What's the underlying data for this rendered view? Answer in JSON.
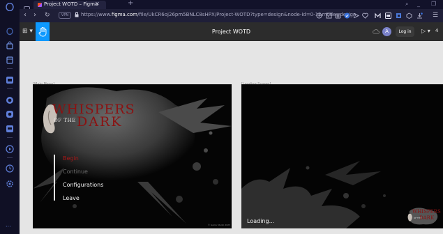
{
  "browser": {
    "tab_title": "Project WOTD – Figma",
    "tab_close": "✕",
    "new_tab": "+",
    "vpn_label": "VPN",
    "url_prefix": "https://www.",
    "url_domain": "figma.com",
    "url_path": "/file/UkCR6oj26pm5BNLC8sHPX/Project-WOTD?type=design&node-id=0-1&mode=design",
    "window_minimize": "_",
    "window_search": "⌕",
    "window_restore": "❐"
  },
  "figma": {
    "menu": "⊞ ▾",
    "title": "Project WOTD",
    "avatar_letter": "A",
    "login_label": "Log in",
    "play_label": "▷ ▾",
    "zoom_label": "4"
  },
  "canvas": {
    "frame_main_label": "Main Menu",
    "frame_loading_label": "Loading Screen",
    "game_title_line1": "WHISPERS",
    "game_title_of": "OF THE",
    "game_title_line2": "DARK",
    "menu_items": [
      "Begin",
      "Continue",
      "Configurations",
      "Leave"
    ],
    "copyright": "© Game Studio 2023",
    "loading_text": "Loading...",
    "mini_logo_w": "WHISPERS",
    "mini_logo_of": "OF THE",
    "mini_logo_d": "DARK"
  },
  "colors": {
    "title_red": "#8a1212",
    "begin_red": "#a81818",
    "figma_blue": "#0d99ff",
    "canvas_bg": "#e5e5e5"
  }
}
